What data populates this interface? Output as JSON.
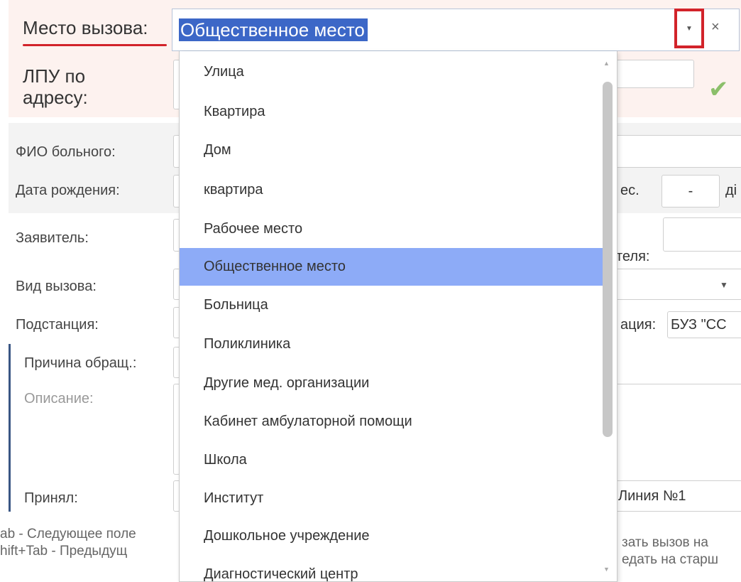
{
  "form": {
    "call_place_label": "Место вызова:",
    "call_place_value": "Общественное место",
    "lpu_label_line1": "ЛПУ по",
    "lpu_label_line2": "адресу:",
    "fio_label": "ФИО больного:",
    "birth_label": "Дата рождения:",
    "birth_suffix_fragment": "ес.",
    "birth_days_fragment": "ді",
    "birth_dash_value": "-",
    "applicant_label": "Заявитель:",
    "applicant_suffix_fragment": "теля:",
    "call_type_label": "Вид вызова:",
    "substation_label": "Подстанция:",
    "organization_fragment": "ация:",
    "organization_value_fragment": "БУЗ \"СС",
    "reason_label": "Причина обращ.:",
    "description_label": "Описание:",
    "accepted_label": "Принял:",
    "accepted_value_fragment": "Линия №1"
  },
  "footer": {
    "left_line1": "ab - Следующее поле",
    "left_line2": "hift+Tab - Предыдущ",
    "right_line1": "зать вызов на",
    "right_line2": "едать на старш"
  },
  "combo": {
    "dropdown_icon": "caret-down-icon",
    "clear_icon": "close-icon",
    "clear_glyph": "×",
    "caret_glyph": "▼"
  },
  "dropdown": {
    "selected_index": 5,
    "items": [
      "Улица",
      "Квартира",
      "Дом",
      "квартира",
      "Рабочее место",
      "Общественное место",
      "Больница",
      "Поликлиника",
      "Другие мед. организации",
      "Кабинет амбулаторной помощи",
      "Школа",
      "Институт",
      "Дошкольное учреждение",
      "Диагностический центр"
    ]
  },
  "colors": {
    "highlight": "#3c67c7",
    "selected_item": "#8dabf7",
    "accent_red": "#d2232a",
    "check_green": "#8bbf6a"
  }
}
